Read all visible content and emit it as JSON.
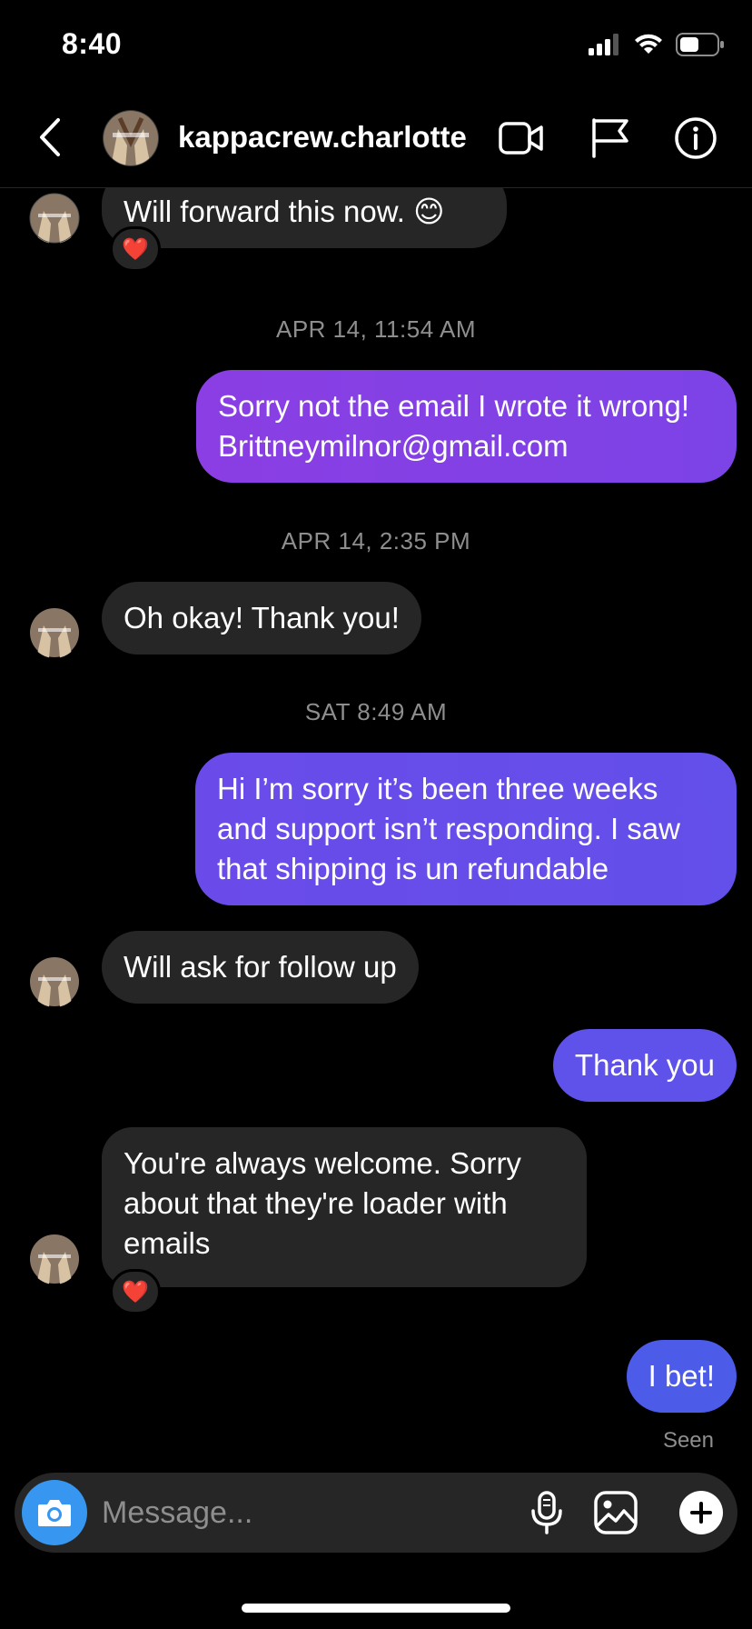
{
  "status_bar": {
    "time": "8:40"
  },
  "header": {
    "username": "kappacrew.charlotte"
  },
  "messages": [
    {
      "type": "incoming",
      "text": "Will forward this now. 😊",
      "reaction": "❤️"
    },
    {
      "type": "timestamp",
      "text": "APR 14, 11:54 AM"
    },
    {
      "type": "outgoing",
      "text": "Sorry not the email I wrote it wrong! Brittneymilnor@gmail.com"
    },
    {
      "type": "timestamp",
      "text": "APR 14, 2:35 PM"
    },
    {
      "type": "incoming",
      "text": "Oh okay! Thank you!"
    },
    {
      "type": "timestamp",
      "text": "SAT 8:49 AM"
    },
    {
      "type": "outgoing",
      "text": "Hi I’m sorry it’s been three weeks and support isn’t responding. I saw that shipping is un refundable"
    },
    {
      "type": "incoming",
      "text": "Will ask for follow up"
    },
    {
      "type": "outgoing",
      "text": "Thank you"
    },
    {
      "type": "incoming",
      "text": "You're always welcome. Sorry about that they're loader with emails",
      "reaction": "❤️"
    },
    {
      "type": "outgoing",
      "text": "I bet!"
    }
  ],
  "seen_label": "Seen",
  "composer": {
    "placeholder": "Message..."
  },
  "colors": {
    "incoming_bubble": "#262626",
    "outgoing_gradient": [
      "#8a3ee3",
      "#7c43e6",
      "#6a4bea",
      "#5e52ea",
      "#4d5ce8"
    ],
    "camera_button": "#3797f0"
  },
  "icons": [
    "back-chevron-icon",
    "video-call-icon",
    "flag-icon",
    "info-icon",
    "camera-icon",
    "microphone-icon",
    "gallery-icon",
    "plus-icon"
  ]
}
